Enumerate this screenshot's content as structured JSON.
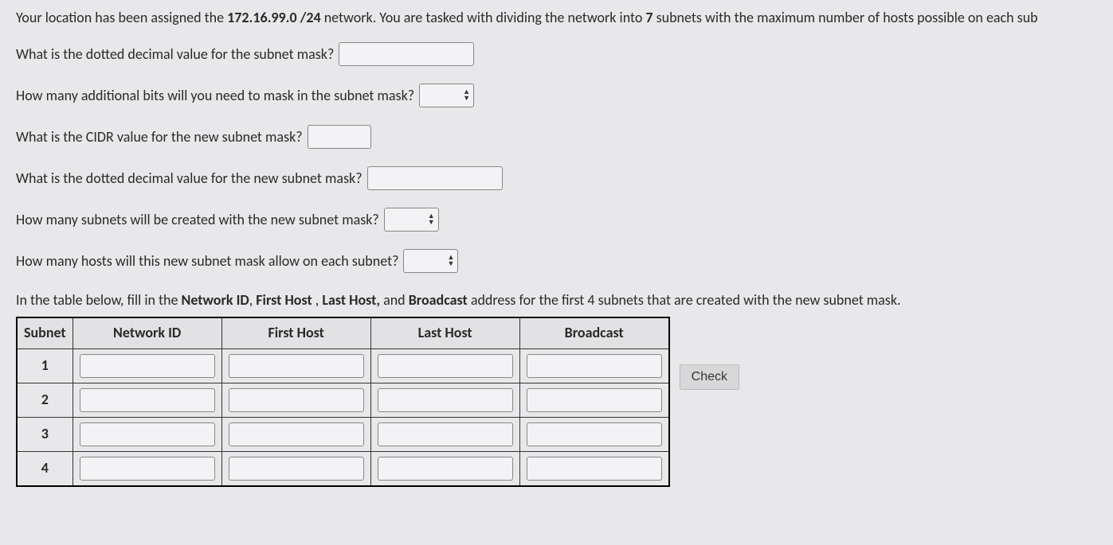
{
  "intro": {
    "pre": "Your location has been assigned the ",
    "network": "172.16.99.0 /24",
    "mid": " network.  You are tasked with dividing the network into ",
    "subnets": "7",
    "post": " subnets with the maximum number of hosts possible on each sub"
  },
  "q1": {
    "label": "What is the dotted decimal value for the subnet mask?",
    "value": ""
  },
  "q2": {
    "label": "How many additional bits will you need to mask in the subnet mask?",
    "value": ""
  },
  "q3": {
    "label": "What is the CIDR value for the new subnet mask?",
    "value": ""
  },
  "q4": {
    "label": "What is the dotted decimal value for the new subnet mask?",
    "value": ""
  },
  "q5": {
    "label": "How many subnets will be created with the new subnet mask?",
    "value": ""
  },
  "q6": {
    "label": "How many hosts will this new subnet mask allow on each subnet?",
    "value": ""
  },
  "tableIntro": {
    "pre": "In the table below, fill in the ",
    "f1": "Network ID",
    "sep1": ", ",
    "f2": "First Host",
    "sep2": " , ",
    "f3": "Last Host,",
    "sep3": " and ",
    "f4": "Broadcast",
    "post": " address for the first 4 subnets that are created with the new subnet mask."
  },
  "headers": {
    "subnet": "Subnet",
    "netid": "Network ID",
    "first": "First Host",
    "last": "Last Host",
    "bcast": "Broadcast"
  },
  "rows": [
    {
      "n": "1",
      "netid": "",
      "first": "",
      "last": "",
      "bcast": ""
    },
    {
      "n": "2",
      "netid": "",
      "first": "",
      "last": "",
      "bcast": ""
    },
    {
      "n": "3",
      "netid": "",
      "first": "",
      "last": "",
      "bcast": ""
    },
    {
      "n": "4",
      "netid": "",
      "first": "",
      "last": "",
      "bcast": ""
    }
  ],
  "check": "Check"
}
